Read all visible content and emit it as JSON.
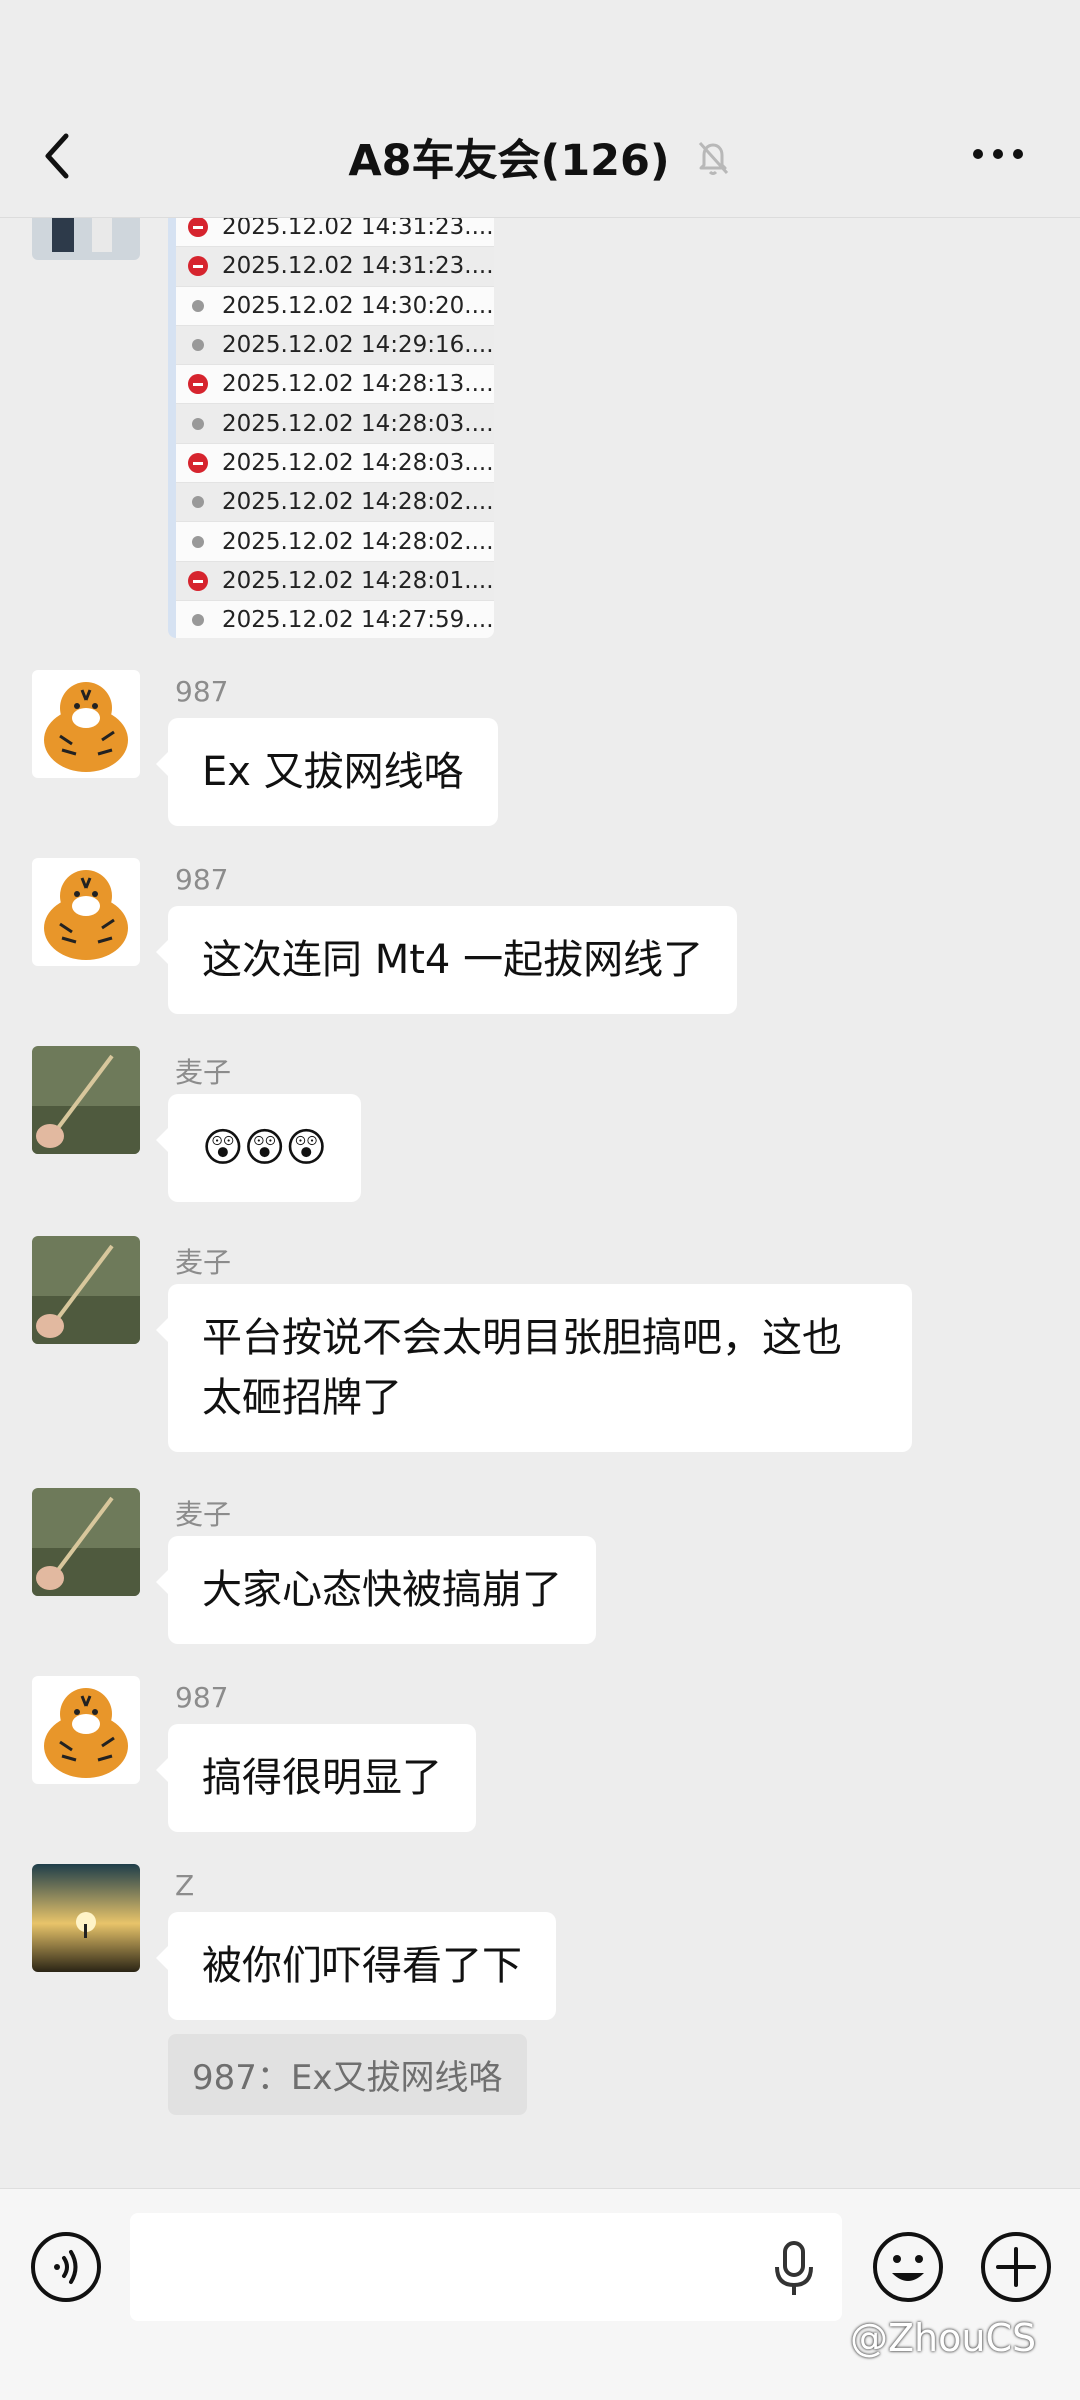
{
  "header": {
    "title": "A8车友会(126)",
    "back_icon": "chevron-left-icon",
    "mute_icon": "bell-off-icon",
    "more_icon": "more-dots-icon"
  },
  "log_image": {
    "rows": [
      {
        "time": "2025.12.02 14:31:23....",
        "status": "error"
      },
      {
        "time": "2025.12.02 14:31:23....",
        "status": "error"
      },
      {
        "time": "2025.12.02 14:30:20....",
        "status": "info"
      },
      {
        "time": "2025.12.02 14:29:16....",
        "status": "info"
      },
      {
        "time": "2025.12.02 14:28:13....",
        "status": "error"
      },
      {
        "time": "2025.12.02 14:28:03....",
        "status": "info"
      },
      {
        "time": "2025.12.02 14:28:03....",
        "status": "error"
      },
      {
        "time": "2025.12.02 14:28:02....",
        "status": "info"
      },
      {
        "time": "2025.12.02 14:28:02....",
        "status": "info"
      },
      {
        "time": "2025.12.02 14:28:01....",
        "status": "error"
      },
      {
        "time": "2025.12.02 14:27:59....",
        "status": "info"
      }
    ]
  },
  "messages": [
    {
      "sender": "987",
      "text": "Ex 又拔网线咯"
    },
    {
      "sender": "987",
      "text": "这次连同 Mt4 一起拔网线了"
    },
    {
      "sender": "麦子",
      "text": "😲😲😲"
    },
    {
      "sender": "麦子",
      "text": "平台按说不会太明目张胆搞吧，这也太砸招牌了"
    },
    {
      "sender": "麦子",
      "text": "大家心态快被搞崩了"
    },
    {
      "sender": "987",
      "text": "搞得很明显了"
    },
    {
      "sender": "Z",
      "text": "被你们吓得看了下"
    }
  ],
  "quote": {
    "text": "987：Ex又拔网线咯"
  },
  "input_bar": {
    "placeholder": "",
    "voice_icon": "voice-icon",
    "mic_icon": "mic-icon",
    "emoji_icon": "emoji-icon",
    "plus_icon": "plus-icon"
  },
  "watermark": {
    "text": "@ZhouCS"
  }
}
